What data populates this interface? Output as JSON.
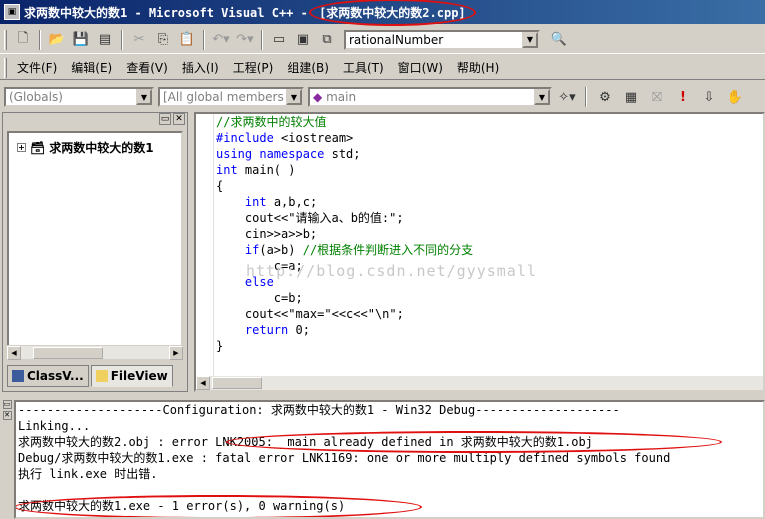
{
  "titlebar": {
    "app_title": "求两数中较大的数1 - Microsoft Visual C++ - ",
    "file": "[求两数中较大的数2.cpp]",
    "icon": "msdev-app-icon"
  },
  "toolbar": {
    "find_combo_value": "rationalNumber"
  },
  "menu": [
    "文件(F)",
    "编辑(E)",
    "查看(V)",
    "插入(I)",
    "工程(P)",
    "组建(B)",
    "工具(T)",
    "窗口(W)",
    "帮助(H)"
  ],
  "wizard": {
    "class_combo": "(Globals)",
    "filter_combo": "[All global members",
    "member_combo": "main"
  },
  "workspace": {
    "tree_root": "求两数中较大的数1",
    "tabs": [
      "ClassV...",
      "FileView"
    ]
  },
  "editor": {
    "lines": [
      {
        "text": "//求两数中的较大值",
        "type": "comment"
      },
      {
        "text": "#include <iostream>",
        "type": "include"
      },
      {
        "text": "using namespace std;",
        "type": "using"
      },
      {
        "text": "int main( )",
        "type": "main"
      },
      {
        "text": "{",
        "type": "plain"
      },
      {
        "text": "    int a,b,c;",
        "type": "decl"
      },
      {
        "text": "    cout<<\"请输入a、b的值:\";",
        "type": "plain"
      },
      {
        "text": "    cin>>a>>b;",
        "type": "plain"
      },
      {
        "text": "    if(a>b) //根据条件判断进入不同的分支",
        "type": "if"
      },
      {
        "text": "        c=a;",
        "type": "plain"
      },
      {
        "text": "    else",
        "type": "else"
      },
      {
        "text": "        c=b;",
        "type": "plain"
      },
      {
        "text": "    cout<<\"max=\"<<c<<\"\\n\";",
        "type": "plain"
      },
      {
        "text": "    return 0;",
        "type": "return"
      },
      {
        "text": "}",
        "type": "plain"
      }
    ],
    "watermark": "http://blog.csdn.net/gyysmall"
  },
  "output": {
    "lines": [
      "--------------------Configuration: 求两数中较大的数1 - Win32 Debug--------------------",
      "Linking...",
      "求两数中较大的数2.obj : error LNK2005: _main already defined in 求两数中较大的数1.obj",
      "Debug/求两数中较大的数1.exe : fatal error LNK1169: one or more multiply defined symbols found",
      "执行 link.exe 时出错.",
      "",
      "求两数中较大的数1.exe - 1 error(s), 0 warning(s)"
    ]
  },
  "colors": {
    "keyword": "#0000ff",
    "comment": "#008000",
    "highlight_oval": "#e01010",
    "titlebar": "#0a246a"
  }
}
